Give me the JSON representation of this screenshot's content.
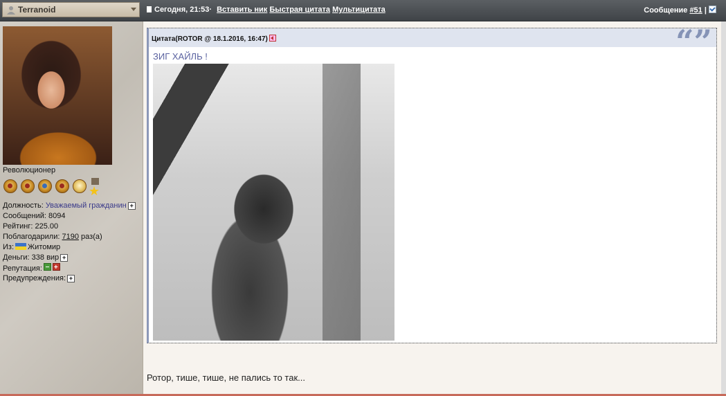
{
  "topbar": {
    "username": "Terranoid",
    "post_time": "Сегодня, 21:53",
    "insert_nick": "Вставить ник",
    "quick_quote": "Быстрая цитата",
    "multi_quote": "Мультицитата",
    "post_label": "Сообщение",
    "post_number": "#51",
    "separator": "|"
  },
  "user": {
    "rank": "Революционер",
    "position_label": "Должность:",
    "position_value": "Уважаемый гражданин",
    "posts_label": "Сообщений:",
    "posts_value": "8094",
    "rating_label": "Рейтинг:",
    "rating_value": "225.00",
    "thanked_label": "Поблагодарили:",
    "thanked_value": "7190",
    "thanked_suffix": "раз(а)",
    "from_label": "Из:",
    "from_value": "Житомир",
    "money_label": "Деньги:",
    "money_value": "338 вир",
    "reputation_label": "Репутация:",
    "warnings_label": "Предупреждения:",
    "plus_symbol": "+"
  },
  "quote": {
    "header": "Цитата(ROTOR @ 18.1.2016, 16:47)",
    "text": "ЗИГ ХАЙЛЬ !",
    "marks": "“”"
  },
  "reply": {
    "text": "Ротор, тише, тише, не пались то так..."
  },
  "colors": {
    "topbar": "#4a4e52",
    "quote_border": "#8c98b8",
    "quote_text": "#5a62a0",
    "link": "#3a3a8a"
  }
}
